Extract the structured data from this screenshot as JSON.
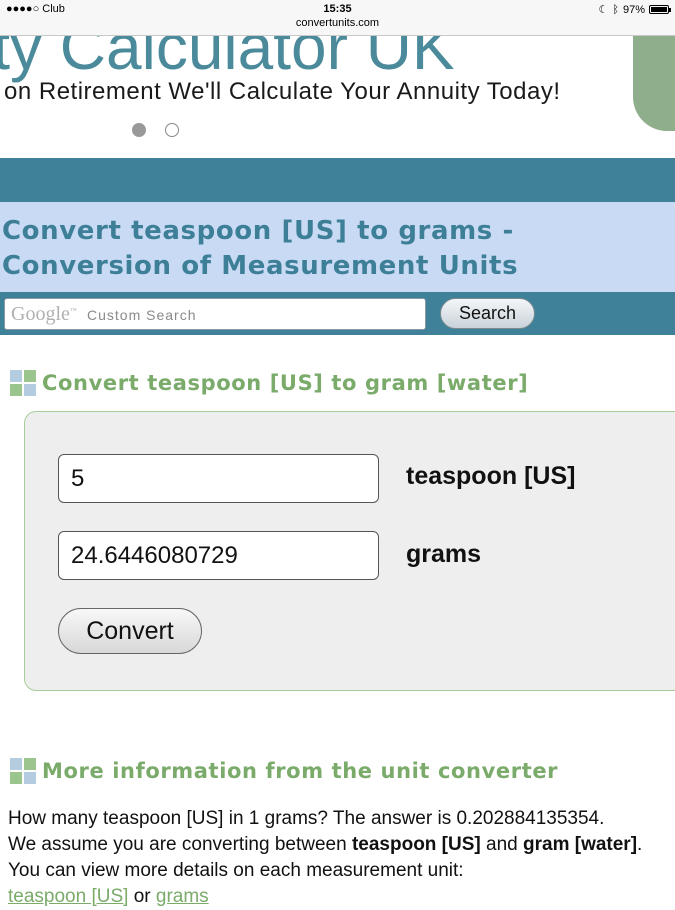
{
  "status_bar": {
    "carrier": "●●●●○ Club",
    "time": "15:35",
    "url": "convertunits.com",
    "battery": "97%",
    "battery_level": 0.97
  },
  "banner": {
    "headline": "ity Calculator UK",
    "subline": "on Retirement We'll Calculate Your Annuity Today!"
  },
  "page_title": {
    "line1": "Convert teaspoon [US] to grams -",
    "line2": "Conversion of Measurement Units"
  },
  "search": {
    "logo": "Google",
    "logo_tm": "™",
    "placeholder": "Custom Search",
    "button_label": "Search"
  },
  "converter": {
    "heading": "Convert teaspoon [US] to gram [water]",
    "from_value": "5",
    "from_unit": "teaspoon [US]",
    "to_value": "24.6446080729",
    "to_unit": "grams",
    "convert_label": "Convert"
  },
  "more_info": {
    "heading": "More information from the unit converter",
    "line1": "How many teaspoon [US] in 1 grams? The answer is 0.202884135354.",
    "line2_pre": "We assume you are converting between ",
    "line2_b1": "teaspoon [US]",
    "line2_mid": " and ",
    "line2_b2": "gram [water]",
    "line2_end": ".",
    "line3": "You can view more details on each measurement unit:",
    "link1": "teaspoon [US]",
    "link_sep": " or ",
    "link2": "grams"
  },
  "colors": {
    "teal": "#3f8199",
    "light_blue": "#c9daf4",
    "green": "#7aab6a"
  }
}
